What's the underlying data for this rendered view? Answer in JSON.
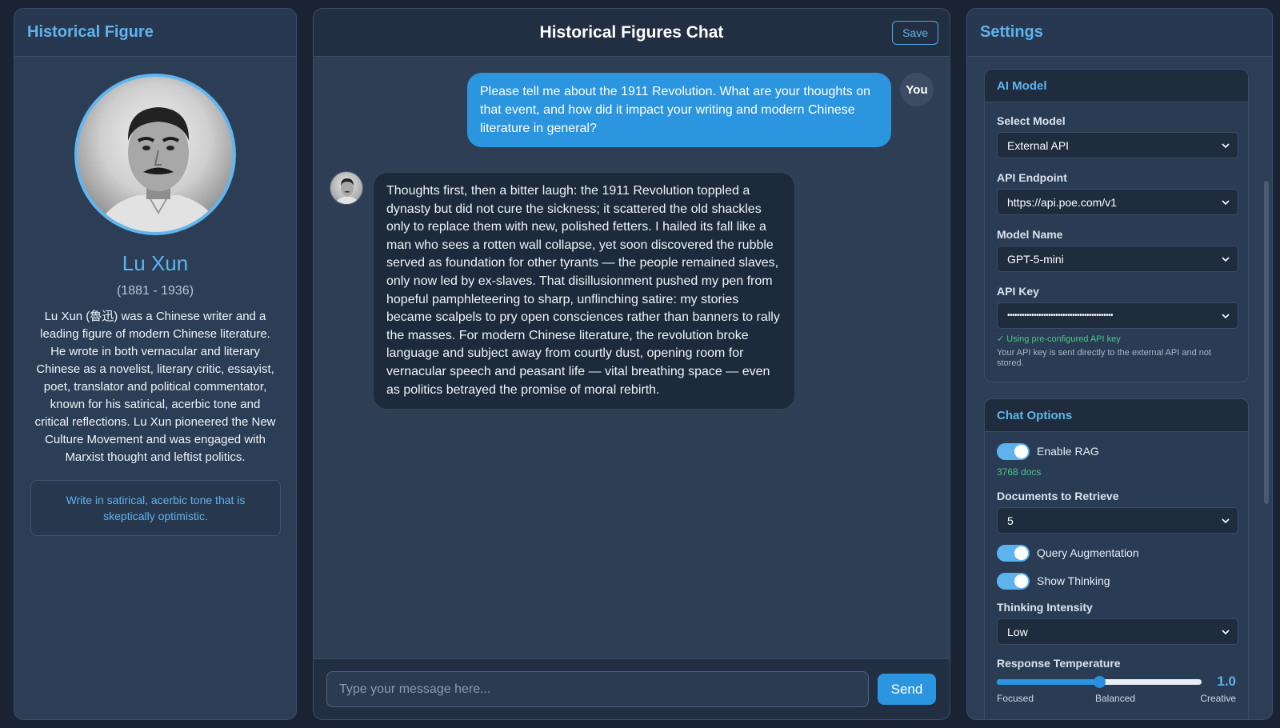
{
  "left": {
    "title": "Historical Figure",
    "name": "Lu Xun",
    "years": "(1881 - 1936)",
    "bio": "Lu Xun (魯迅) was a Chinese writer and a leading figure of modern Chinese literature. He wrote in both vernacular and literary Chinese as a novelist, literary critic, essayist, poet, translator and political commentator, known for his satirical, acerbic tone and critical reflections. Lu Xun pioneered the New Culture Movement and was engaged with Marxist thought and leftist politics.",
    "tone": "Write in satirical, acerbic tone that is skeptically optimistic."
  },
  "chat": {
    "title": "Historical Figures Chat",
    "save_label": "Save",
    "user_label": "You",
    "user_message": "Please tell me about the 1911 Revolution. What are your thoughts on that event, and how did it impact your writing and modern Chinese literature in general?",
    "bot_message": "Thoughts first, then a bitter laugh: the 1911 Revolution toppled a dynasty but did not cure the sickness; it scattered the old shackles only to replace them with new, polished fetters. I hailed its fall like a man who sees a rotten wall collapse, yet soon discovered the rubble served as foundation for other tyrants — the people remained slaves, only now led by ex-slaves. That disillusionment pushed my pen from hopeful pamphleteering to sharp, unflinching satire: my stories became scalpels to pry open consciences rather than banners to rally the masses. For modern Chinese literature, the revolution broke language and subject away from courtly dust, opening room for vernacular speech and peasant life — vital breathing space — even as politics betrayed the promise of moral rebirth.",
    "input_placeholder": "Type your message here...",
    "send_label": "Send"
  },
  "settings": {
    "title": "Settings",
    "ai_model": {
      "header": "AI Model",
      "select_model_label": "Select Model",
      "select_model_value": "External API",
      "endpoint_label": "API Endpoint",
      "endpoint_value": "https://api.poe.com/v1",
      "model_name_label": "Model Name",
      "model_name_value": "GPT-5-mini",
      "api_key_label": "API Key",
      "api_key_value": "••••••••••••••••••••••••••••••••••••••••••••",
      "api_key_status": "✓ Using pre-configured API key",
      "api_key_note": "Your API key is sent directly to the external API and not stored."
    },
    "chat_options": {
      "header": "Chat Options",
      "enable_rag_label": "Enable RAG",
      "enable_rag_on": true,
      "docs_count": "3768 docs",
      "docs_retrieve_label": "Documents to Retrieve",
      "docs_retrieve_value": "5",
      "query_aug_label": "Query Augmentation",
      "query_aug_on": true,
      "show_thinking_label": "Show Thinking",
      "show_thinking_on": true,
      "thinking_intensity_label": "Thinking Intensity",
      "thinking_intensity_value": "Low",
      "temperature_label": "Response Temperature",
      "temperature_value": "1.0",
      "temperature_fraction": 0.5,
      "temp_low_label": "Focused",
      "temp_mid_label": "Balanced",
      "temp_high_label": "Creative"
    }
  },
  "colors": {
    "accent": "#5fb3ec",
    "user_bubble": "#2b95e0",
    "panel_bg": "#2c3e55",
    "page_bg": "#1a2333",
    "success": "#4cc38a"
  }
}
